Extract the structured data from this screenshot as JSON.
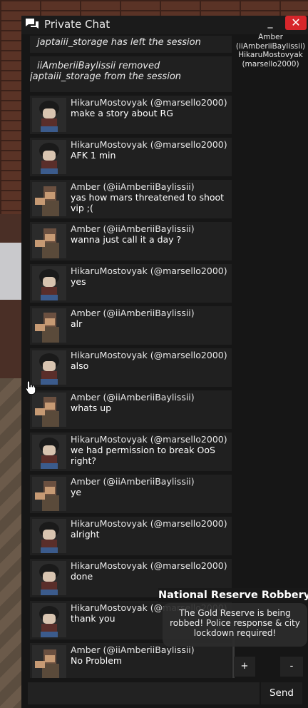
{
  "window": {
    "title": "Private Chat",
    "minimize_label": "_",
    "close_label": "✕"
  },
  "members": [
    "Amber",
    "(iiAmberiiBaylissii)",
    "HikaruMostovyak",
    "(marsello2000)"
  ],
  "system_messages": [
    "japtaiii_storage has left the session",
    "iiAmberiiBaylissii removed japtaiii_storage from the session"
  ],
  "messages": [
    {
      "sender": "HikaruMostovyak (@marsello2000)",
      "text": "make a story about RG",
      "avatar": "hikaru"
    },
    {
      "sender": "HikaruMostovyak (@marsello2000)",
      "text": "AFK 1 min",
      "avatar": "hikaru"
    },
    {
      "sender": "Amber (@iiAmberiiBaylissii)",
      "text": "yas how mars threatened to shoot vip ;(",
      "avatar": "amber"
    },
    {
      "sender": "Amber (@iiAmberiiBaylissii)",
      "text": "wanna just call it a day ?",
      "avatar": "amber"
    },
    {
      "sender": "HikaruMostovyak (@marsello2000)",
      "text": "yes",
      "avatar": "hikaru"
    },
    {
      "sender": "Amber (@iiAmberiiBaylissii)",
      "text": "alr",
      "avatar": "amber"
    },
    {
      "sender": "HikaruMostovyak (@marsello2000)",
      "text": "also",
      "avatar": "hikaru"
    },
    {
      "sender": "Amber (@iiAmberiiBaylissii)",
      "text": "whats up",
      "avatar": "amber"
    },
    {
      "sender": "HikaruMostovyak (@marsello2000)",
      "text": "we had permission to break OoS right?",
      "avatar": "hikaru"
    },
    {
      "sender": "Amber (@iiAmberiiBaylissii)",
      "text": "ye",
      "avatar": "amber"
    },
    {
      "sender": "HikaruMostovyak (@marsello2000)",
      "text": "alright",
      "avatar": "hikaru"
    },
    {
      "sender": "HikaruMostovyak (@marsello2000)",
      "text": "done",
      "avatar": "hikaru"
    },
    {
      "sender": "HikaruMostovyak (@marsello2000)",
      "text": "thank you",
      "avatar": "hikaru"
    },
    {
      "sender": "Amber (@iiAmberiiBaylissii)",
      "text": "No Problem",
      "avatar": "amber"
    }
  ],
  "controls": {
    "plus_label": "+",
    "minus_label": "-",
    "send_label": "Send",
    "input_value": ""
  },
  "notification": {
    "title": "National Reserve Robbery",
    "body": "The Gold Reserve is being robbed! Police response & city lockdown required!"
  },
  "colors": {
    "close_button": "#d7262b",
    "window_bg": "#161616",
    "message_bg": "#202020"
  }
}
